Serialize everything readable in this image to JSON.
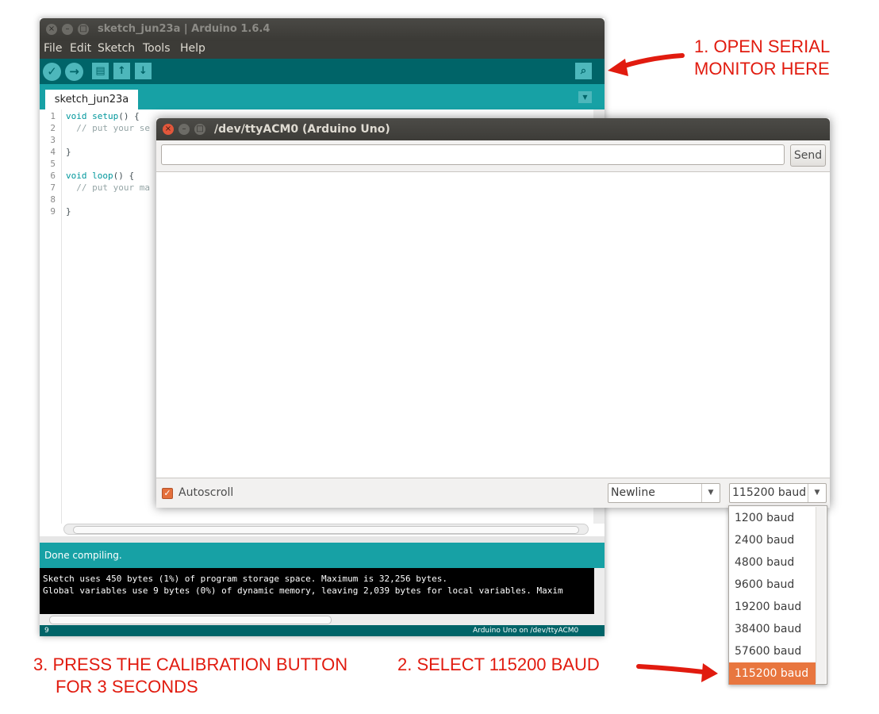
{
  "ide": {
    "title": "sketch_jun23a | Arduino 1.6.4",
    "window_controls": [
      "×",
      "–",
      "□"
    ],
    "menu": [
      "File",
      "Edit",
      "Sketch",
      "Tools",
      "Help"
    ],
    "toolbar": {
      "verify_icon": "checkmark-icon",
      "upload_icon": "arrow-right-icon",
      "new_icon": "new-file-icon",
      "open_icon": "arrow-up-icon",
      "save_icon": "arrow-down-icon",
      "serial_monitor_icon": "magnifier-icon"
    },
    "tab_label": "sketch_jun23a",
    "code_lines": [
      {
        "n": "1",
        "segments": [
          {
            "t": "void",
            "c": "kw"
          },
          {
            "t": " "
          },
          {
            "t": "setup",
            "c": "kw"
          },
          {
            "t": "() {"
          }
        ]
      },
      {
        "n": "2",
        "segments": [
          {
            "t": "  // put your se",
            "c": "cmt"
          }
        ]
      },
      {
        "n": "3",
        "segments": []
      },
      {
        "n": "4",
        "segments": [
          {
            "t": "}"
          }
        ]
      },
      {
        "n": "5",
        "segments": []
      },
      {
        "n": "6",
        "segments": [
          {
            "t": "void",
            "c": "kw"
          },
          {
            "t": " "
          },
          {
            "t": "loop",
            "c": "kw"
          },
          {
            "t": "() {"
          }
        ]
      },
      {
        "n": "7",
        "segments": [
          {
            "t": "  // put your ma",
            "c": "cmt"
          }
        ]
      },
      {
        "n": "8",
        "segments": []
      },
      {
        "n": "9",
        "segments": [
          {
            "t": "}"
          }
        ]
      }
    ],
    "status": "Done compiling.",
    "console_lines": [
      "Sketch uses 450 bytes (1%) of program storage space. Maximum is 32,256 bytes.",
      "Global variables use 9 bytes (0%) of dynamic memory, leaving 2,039 bytes for local variables. Maxim"
    ],
    "bottom_line": "9",
    "bottom_board": "Arduino Uno on /dev/ttyACM0"
  },
  "serial": {
    "title": "/dev/ttyACM0 (Arduino Uno)",
    "input_value": "",
    "send_label": "Send",
    "autoscroll_label": "Autoscroll",
    "autoscroll_checked": true,
    "line_ending": "Newline",
    "baud": "115200 baud",
    "baud_options": [
      "1200 baud",
      "2400 baud",
      "4800 baud",
      "9600 baud",
      "19200 baud",
      "38400 baud",
      "57600 baud",
      "115200 baud"
    ],
    "baud_selected_index": 7
  },
  "annotations": {
    "step1_line1": "1. OPEN SERIAL",
    "step1_line2": "MONITOR HERE",
    "step2": "2. SELECT 115200 BAUD",
    "step3_line1": "3. PRESS THE CALIBRATION BUTTON",
    "step3_line2": "FOR 3 SECONDS",
    "color": "#e11b0f"
  }
}
